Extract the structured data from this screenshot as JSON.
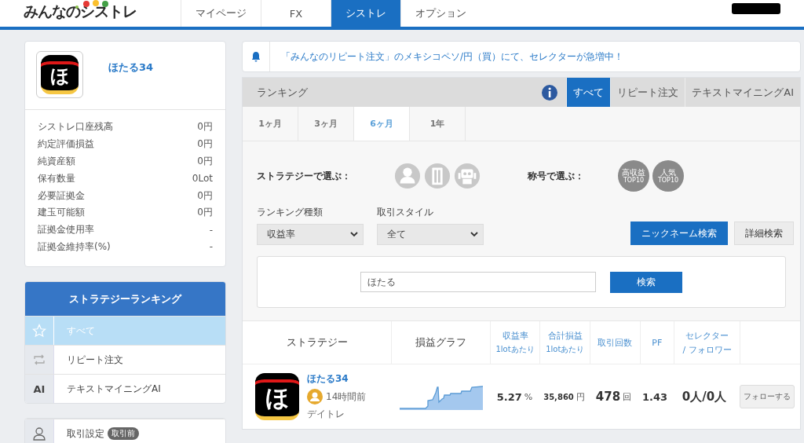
{
  "header": {
    "logo": "みんなのシストレ",
    "nav": [
      {
        "label": "マイページ",
        "selected": false
      },
      {
        "label": "FX",
        "selected": false
      },
      {
        "label": "シストレ",
        "selected": true
      },
      {
        "label": "オプション",
        "selected": false
      }
    ]
  },
  "profile": {
    "avatar_glyph": "ほ",
    "name": "ほたる34",
    "stats": [
      {
        "label": "シストレ口座残高",
        "value": "0円"
      },
      {
        "label": "約定評価損益",
        "value": "0円"
      },
      {
        "label": "純資産額",
        "value": "0円"
      },
      {
        "label": "保有数量",
        "value": "0Lot"
      },
      {
        "label": "必要証拠金",
        "value": "0円"
      },
      {
        "label": "建玉可能額",
        "value": "0円"
      },
      {
        "label": "証拠金使用率",
        "value": "-"
      },
      {
        "label": "証拠金維持率(%)",
        "value": "-"
      }
    ]
  },
  "strategy_menu": {
    "title": "ストラテジーランキング",
    "items": [
      {
        "kind": "star",
        "label": "すべて",
        "selected": true
      },
      {
        "kind": "repeat",
        "label": "リピート注文",
        "selected": false
      },
      {
        "kind": "text",
        "icon_text": "AI",
        "label": "テキストマイニングAI",
        "selected": false
      }
    ]
  },
  "settings_item": {
    "label": "取引設定",
    "badge": "取引前"
  },
  "notice": "「みんなのリピート注文」のメキシコペソ/円（買）にて、セレクターが急増中！",
  "ranking": {
    "title": "ランキング",
    "tabs": [
      {
        "label": "すべて",
        "selected": true
      },
      {
        "label": "リピート注文",
        "selected": false
      },
      {
        "label": "テキストマイニングAI",
        "selected": false
      }
    ],
    "periods": [
      {
        "label": "1ヶ月",
        "selected": false
      },
      {
        "label": "3ヶ月",
        "selected": false
      },
      {
        "label": "6ヶ月",
        "selected": true
      },
      {
        "label": "1年",
        "selected": false
      }
    ],
    "strategy_filter_label": "ストラテジーで選ぶ：",
    "title_filter_label": "称号で選ぶ：",
    "title_badges": [
      {
        "main": "高収益",
        "sub": "TOP10"
      },
      {
        "main": "人気",
        "sub": "TOP10"
      }
    ],
    "selects": [
      {
        "label": "ランキング種類",
        "value": "収益率"
      },
      {
        "label": "取引スタイル",
        "value": "全て"
      }
    ],
    "search_modes": [
      {
        "label": "ニックネーム検索",
        "selected": true
      },
      {
        "label": "詳細検索",
        "selected": false
      }
    ],
    "search": {
      "value": "ほたる",
      "button": "検索"
    },
    "columns": [
      {
        "main": "ストラテジー"
      },
      {
        "main": "損益グラフ"
      },
      {
        "main": "収益率",
        "sub": "1lotあたり"
      },
      {
        "main": "合計損益",
        "sub": "1lotあたり"
      },
      {
        "main": "取引回数"
      },
      {
        "main": "PF"
      },
      {
        "main": "セレクター",
        "sub": "/ フォロワー"
      }
    ],
    "rows": [
      {
        "avatar_glyph": "ほ",
        "name": "ほたる34",
        "updated": "14時間前",
        "style": "デイトレ",
        "return": "5.27",
        "return_unit": "%",
        "profit": "35,860",
        "profit_unit": "円",
        "trades": "478",
        "trades_unit": "回",
        "pf": "1.43",
        "selectors": "0人/0人",
        "follow": "フォローする"
      }
    ]
  }
}
